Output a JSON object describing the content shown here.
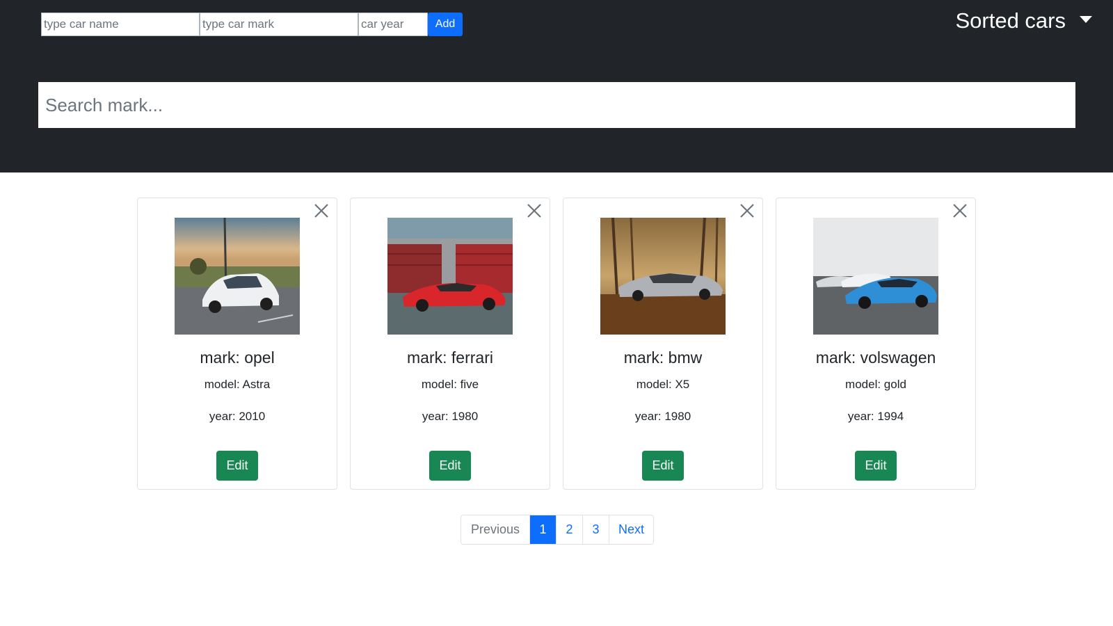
{
  "header": {
    "inputs": {
      "name_placeholder": "type car name",
      "mark_placeholder": "type car mark",
      "year_placeholder": "car year"
    },
    "add_label": "Add",
    "sort_label": "Sorted cars",
    "search_placeholder": "Search mark..."
  },
  "cards": [
    {
      "mark": "mark: opel",
      "model": "model: Astra",
      "year": "year: 2010",
      "edit_label": "Edit",
      "photo": "white opel astra hatchback"
    },
    {
      "mark": "mark: ferrari",
      "model": "model: five",
      "year": "year: 1980",
      "edit_label": "Edit",
      "photo": "red ferrari in front of garage"
    },
    {
      "mark": "mark: bmw",
      "model": "model: X5",
      "year": "year: 1980",
      "edit_label": "Edit",
      "photo": "silver bmw in autumn forest"
    },
    {
      "mark": "mark: volswagen",
      "model": "model: gold",
      "year": "year: 1994",
      "edit_label": "Edit",
      "photo": "blue volkswagen coupe"
    }
  ],
  "pagination": {
    "previous": "Previous",
    "pages": [
      "1",
      "2",
      "3"
    ],
    "active_page": "1",
    "next": "Next"
  },
  "colors": {
    "header_bg": "#212529",
    "primary": "#0d6efd",
    "success": "#198754"
  }
}
